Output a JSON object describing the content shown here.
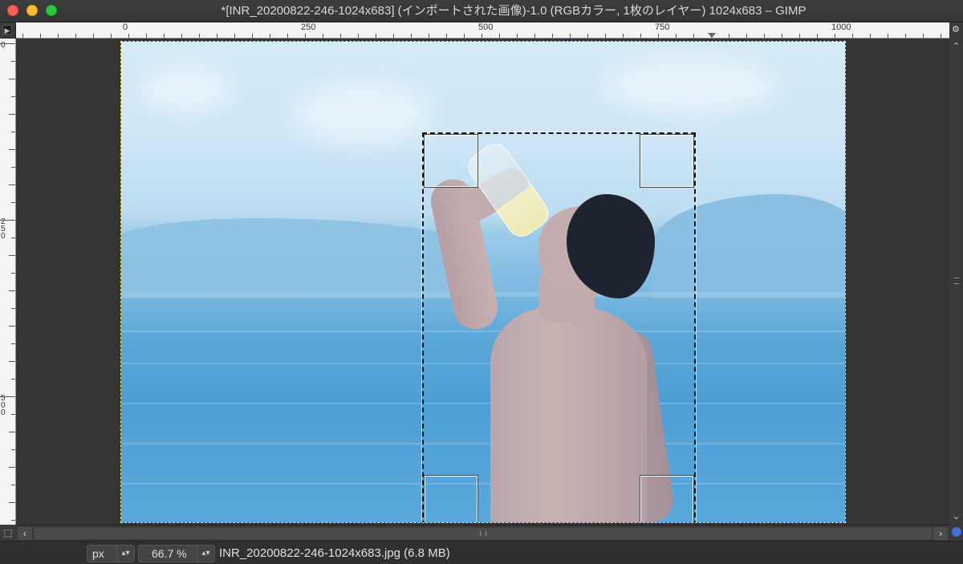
{
  "window": {
    "title": "*[INR_20200822-246-1024x683] (インポートされた画像)-1.0 (RGBカラー, 1枚のレイヤー) 1024x683 – GIMP"
  },
  "rulers": {
    "horizontal_labels": [
      "0",
      "250",
      "500",
      "750",
      "1000"
    ],
    "vertical_labels": [
      "0",
      "250",
      "500"
    ],
    "corner_icon": "menu-triangle-icon"
  },
  "colors": {
    "selection_outline": "#111111",
    "image_boundary": "#ecec40",
    "canvas_bg": "#353535"
  },
  "status": {
    "unit": "px",
    "zoom": "66.7 %",
    "file_info": "INR_20200822-246-1024x683.jpg (6.8 MB)"
  }
}
